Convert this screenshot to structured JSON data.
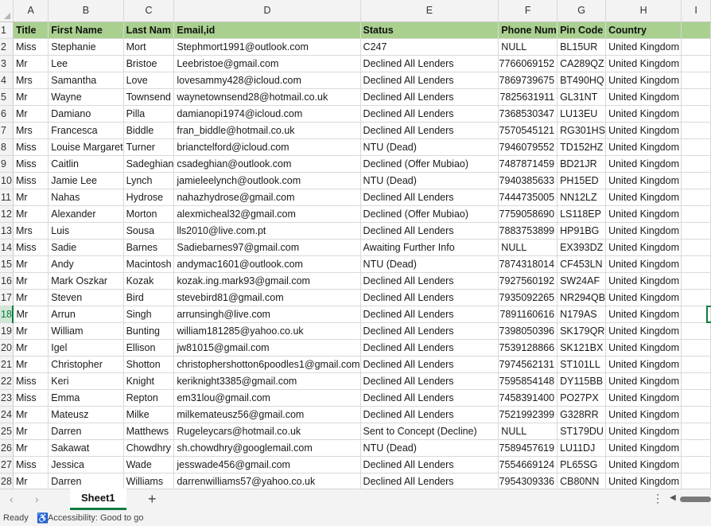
{
  "columns": [
    "A",
    "B",
    "C",
    "D",
    "E",
    "F",
    "G",
    "H",
    "I"
  ],
  "row_numbers": [
    1,
    2,
    3,
    4,
    5,
    6,
    7,
    8,
    9,
    10,
    11,
    12,
    13,
    14,
    15,
    16,
    17,
    18,
    19,
    20,
    21,
    22,
    23,
    24,
    25,
    26,
    27,
    28
  ],
  "header_row": [
    "Title",
    "First Name",
    "Last Nam",
    "Email,id",
    "Status",
    "Phone Num",
    "Pin Code",
    "Country"
  ],
  "rows": [
    [
      "Miss",
      "Stephanie",
      "Mort",
      "Stephmort1991@outlook.com",
      "C247",
      "NULL",
      "BL15UR",
      "United Kingdom"
    ],
    [
      "Mr",
      "Lee",
      "Bristoe",
      "Leebristoe@gmail.com",
      "Declined All Lenders",
      "7766069152",
      "CA289QZ",
      "United Kingdom"
    ],
    [
      "Mrs",
      "Samantha",
      "Love",
      "lovesammy428@icloud.com",
      "Declined All Lenders",
      "7869739675",
      "BT490HQ",
      "United Kingdom"
    ],
    [
      "Mr",
      "Wayne",
      "Townsend",
      "waynetownsend28@hotmail.co.uk",
      "Declined All Lenders",
      "7825631911",
      "GL31NT",
      "United Kingdom"
    ],
    [
      "Mr",
      "Damiano",
      "Pilla",
      "damianopi1974@icloud.com",
      "Declined All Lenders",
      "7368530347",
      "LU13EU",
      "United Kingdom"
    ],
    [
      "Mrs",
      "Francesca",
      "Biddle",
      "fran_biddle@hotmail.co.uk",
      "Declined All Lenders",
      "7570545121",
      "RG301HS",
      "United Kingdom"
    ],
    [
      "Miss",
      "Louise Margaret",
      "Turner",
      "brianctelford@icloud.com",
      "NTU (Dead)",
      "7946079552",
      "TD152HZ",
      "United Kingdom"
    ],
    [
      "Miss",
      "Caitlin",
      "Sadeghian",
      "csadeghian@outlook.com",
      "Declined (Offer Mubiao)",
      "7487871459",
      "BD21JR",
      "United Kingdom"
    ],
    [
      "Miss",
      "Jamie Lee",
      "Lynch",
      "jamieleelynch@outlook.com",
      "NTU (Dead)",
      "7940385633",
      "PH15ED",
      "United Kingdom"
    ],
    [
      "Mr",
      "Nahas",
      "Hydrose",
      "nahazhydrose@gmail.com",
      "Declined All Lenders",
      "7444735005",
      "NN12LZ",
      "United Kingdom"
    ],
    [
      "Mr",
      "Alexander",
      "Morton",
      "alexmicheal32@gmail.com",
      "Declined (Offer Mubiao)",
      "7759058690",
      "LS118EP",
      "United Kingdom"
    ],
    [
      "Mrs",
      "Luis",
      "Sousa",
      "lls2010@live.com.pt",
      "Declined All Lenders",
      "7883753899",
      "HP91BG",
      "United Kingdom"
    ],
    [
      "Miss",
      "Sadie",
      "Barnes",
      "Sadiebarnes97@gmail.com",
      "Awaiting Further Info",
      "NULL",
      "EX393DZ",
      "United Kingdom"
    ],
    [
      "Mr",
      "Andy",
      "Macintosh",
      "andymac1601@outlook.com",
      "NTU (Dead)",
      "7874318014",
      "CF453LN",
      "United Kingdom"
    ],
    [
      "Mr",
      "Mark Oszkar",
      "Kozak",
      "kozak.ing.mark93@gmail.com",
      "Declined All Lenders",
      "7927560192",
      "SW24AF",
      "United Kingdom"
    ],
    [
      "Mr",
      "Steven",
      "Bird",
      "stevebird81@gmail.com",
      "Declined All Lenders",
      "7935092265",
      "NR294QB",
      "United Kingdom"
    ],
    [
      "Mr",
      "Arrun",
      "Singh",
      "arrunsingh@live.com",
      "Declined All Lenders",
      "7891160616",
      "N179AS",
      "United Kingdom"
    ],
    [
      "Mr",
      "William",
      "Bunting",
      "william181285@yahoo.co.uk",
      "Declined All Lenders",
      "7398050396",
      "SK179QR",
      "United Kingdom"
    ],
    [
      "Mr",
      "Igel",
      "Ellison",
      "jw81015@gmail.com",
      "Declined All Lenders",
      "7539128866",
      "SK121BX",
      "United Kingdom"
    ],
    [
      "Mr",
      "Christopher",
      "Shotton",
      "christophershotton6poodles1@gmail.com",
      "Declined All Lenders",
      "7974562131",
      "ST101LL",
      "United Kingdom"
    ],
    [
      "Miss",
      "Keri",
      "Knight",
      "keriknight3385@gmail.com",
      "Declined All Lenders",
      "7595854148",
      "DY115BB",
      "United Kingdom"
    ],
    [
      "Miss",
      "Emma",
      "Repton",
      "em31lou@gmail.com",
      "Declined All Lenders",
      "7458391400",
      "PO27PX",
      "United Kingdom"
    ],
    [
      "Mr",
      "Mateusz",
      "Milke",
      "milkemateusz56@gmail.com",
      "Declined All Lenders",
      "7521992399",
      "G328RR",
      "United Kingdom"
    ],
    [
      "Mr",
      "Darren",
      "Matthews",
      "Rugeleycars@hotmail.co.uk",
      "Sent to Concept (Decline)",
      "NULL",
      "ST179DU",
      "United Kingdom"
    ],
    [
      "Mr",
      "Sakawat",
      "Chowdhry",
      "sh.chowdhry@googlemail.com",
      "NTU (Dead)",
      "7589457619",
      "LU11DJ",
      "United Kingdom"
    ],
    [
      "Miss",
      "Jessica",
      "Wade",
      "jesswade456@gmail.com",
      "Declined All Lenders",
      "7554669124",
      "PL65SG",
      "United Kingdom"
    ],
    [
      "Mr",
      "Darren",
      "Williams",
      "darrenwilliams57@yahoo.co.uk",
      "Declined All Lenders",
      "7954309336",
      "CB80NN",
      "United Kingdom"
    ]
  ],
  "active_row": 18,
  "tabs": {
    "sheet_name": "Sheet1",
    "add_label": "+",
    "prev": "‹",
    "next": "›",
    "more": "⋮"
  },
  "status": {
    "ready": "Ready",
    "accessibility": "Accessibility: Good to go",
    "accessibility_icon": "accessibility-icon"
  },
  "colors": {
    "header_fill": "#a9d08e",
    "accent": "#107c41"
  }
}
